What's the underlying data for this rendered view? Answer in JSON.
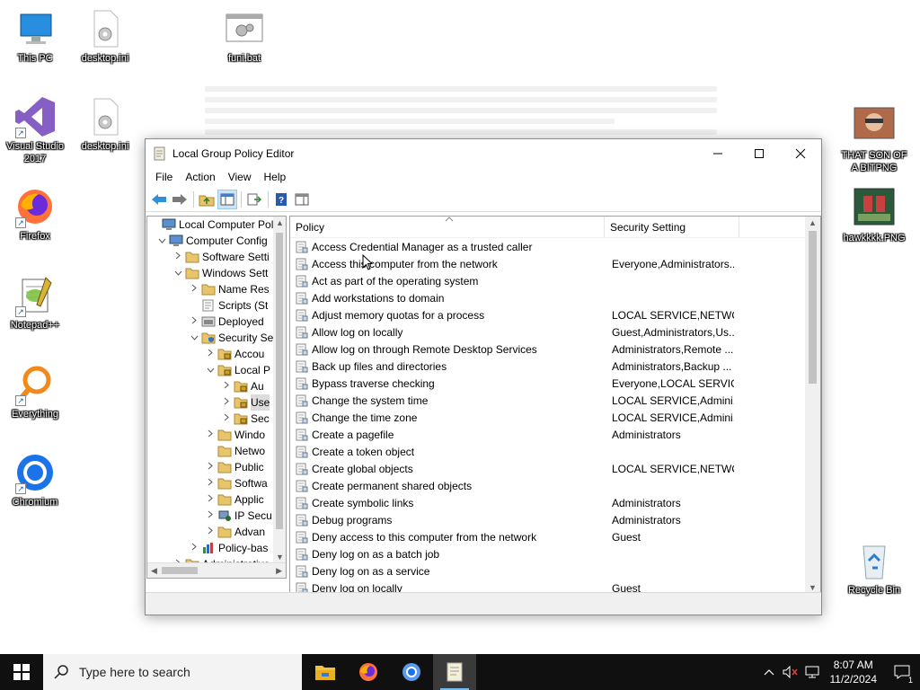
{
  "desktop": {
    "icons": [
      {
        "label": "This PC"
      },
      {
        "label": "desktop.ini"
      },
      {
        "label": "funi.bat"
      },
      {
        "label": "Visual Studio 2017"
      },
      {
        "label": "desktop.ini"
      },
      {
        "label": "THAT SON OF A BITPNG"
      },
      {
        "label": "Firefox"
      },
      {
        "label": "hawkkkk.PNG"
      },
      {
        "label": "Notepad++"
      },
      {
        "label": "Everything"
      },
      {
        "label": "Chromium"
      },
      {
        "label": "Recycle Bin"
      }
    ]
  },
  "window": {
    "title": "Local Group Policy Editor",
    "menu": [
      "File",
      "Action",
      "View",
      "Help"
    ],
    "tree": [
      {
        "label": "Local Computer Polic",
        "expander": ""
      },
      {
        "label": "Computer Config",
        "expander": "v"
      },
      {
        "label": "Software Setti",
        "expander": ">"
      },
      {
        "label": "Windows Sett",
        "expander": "v"
      },
      {
        "label": "Name Res",
        "expander": ">"
      },
      {
        "label": "Scripts (St",
        "expander": ""
      },
      {
        "label": "Deployed",
        "expander": ">"
      },
      {
        "label": "Security Se",
        "expander": "v"
      },
      {
        "label": "Accou",
        "expander": ">"
      },
      {
        "label": "Local P",
        "expander": "v"
      },
      {
        "label": "Au",
        "expander": ">"
      },
      {
        "label": "Use",
        "expander": ">"
      },
      {
        "label": "Sec",
        "expander": ">"
      },
      {
        "label": "Windo",
        "expander": ">"
      },
      {
        "label": "Netwo",
        "expander": ""
      },
      {
        "label": "Public",
        "expander": ">"
      },
      {
        "label": "Softwa",
        "expander": ">"
      },
      {
        "label": "Applic",
        "expander": ">"
      },
      {
        "label": "IP Secu",
        "expander": ">"
      },
      {
        "label": "Advan",
        "expander": ">"
      },
      {
        "label": "Policy-bas",
        "expander": ">"
      },
      {
        "label": "Administrative",
        "expander": ">"
      }
    ],
    "list": {
      "col_policy": "Policy",
      "col_setting": "Security Setting",
      "rows": [
        {
          "policy": "Access Credential Manager as a trusted caller",
          "setting": ""
        },
        {
          "policy": "Access this computer from the network",
          "setting": "Everyone,Administrators..."
        },
        {
          "policy": "Act as part of the operating system",
          "setting": ""
        },
        {
          "policy": "Add workstations to domain",
          "setting": ""
        },
        {
          "policy": "Adjust memory quotas for a process",
          "setting": "LOCAL SERVICE,NETWO..."
        },
        {
          "policy": "Allow log on locally",
          "setting": "Guest,Administrators,Us..."
        },
        {
          "policy": "Allow log on through Remote Desktop Services",
          "setting": "Administrators,Remote ..."
        },
        {
          "policy": "Back up files and directories",
          "setting": "Administrators,Backup ..."
        },
        {
          "policy": "Bypass traverse checking",
          "setting": "Everyone,LOCAL SERVIC..."
        },
        {
          "policy": "Change the system time",
          "setting": "LOCAL SERVICE,Admini..."
        },
        {
          "policy": "Change the time zone",
          "setting": "LOCAL SERVICE,Admini..."
        },
        {
          "policy": "Create a pagefile",
          "setting": "Administrators"
        },
        {
          "policy": "Create a token object",
          "setting": ""
        },
        {
          "policy": "Create global objects",
          "setting": "LOCAL SERVICE,NETWO..."
        },
        {
          "policy": "Create permanent shared objects",
          "setting": ""
        },
        {
          "policy": "Create symbolic links",
          "setting": "Administrators"
        },
        {
          "policy": "Debug programs",
          "setting": "Administrators"
        },
        {
          "policy": "Deny access to this computer from the network",
          "setting": "Guest"
        },
        {
          "policy": "Deny log on as a batch job",
          "setting": ""
        },
        {
          "policy": "Deny log on as a service",
          "setting": ""
        },
        {
          "policy": "Deny log on locally",
          "setting": "Guest"
        }
      ]
    }
  },
  "taskbar": {
    "search_placeholder": "Type here to search",
    "time": "8:07 AM",
    "date": "11/2/2024",
    "notification_count": "1"
  },
  "colors": {
    "taskbar": "#101010",
    "selection": "#cce4f7",
    "folder": "#e8c46a"
  }
}
